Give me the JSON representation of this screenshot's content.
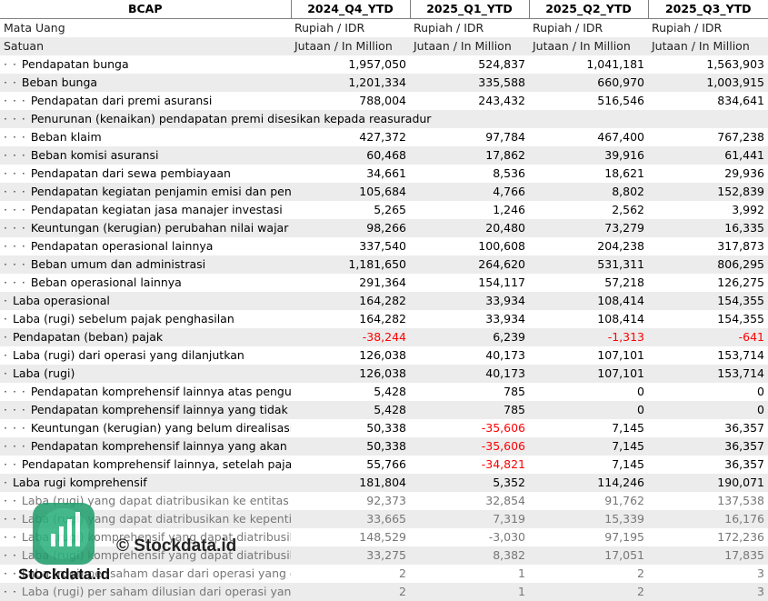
{
  "header": {
    "ticker": "BCAP",
    "periods": [
      "2024_Q4_YTD",
      "2025_Q1_YTD",
      "2025_Q2_YTD",
      "2025_Q3_YTD"
    ]
  },
  "meta_rows": [
    {
      "label": "Mata Uang",
      "values": [
        "Rupiah / IDR",
        "Rupiah / IDR",
        "Rupiah / IDR",
        "Rupiah / IDR"
      ]
    },
    {
      "label": "Satuan",
      "values": [
        "Jutaan / In Million",
        "Jutaan / In Million",
        "Jutaan / In Million",
        "Jutaan / In Million"
      ]
    }
  ],
  "rows": [
    {
      "prefix": "· · ",
      "label": "Pendapatan bunga",
      "values": [
        "1,957,050",
        "524,837",
        "1,041,181",
        "1,563,903"
      ],
      "neg": [
        false,
        false,
        false,
        false
      ]
    },
    {
      "prefix": "· · ",
      "label": "Beban bunga",
      "values": [
        "1,201,334",
        "335,588",
        "660,970",
        "1,003,915"
      ],
      "neg": [
        false,
        false,
        false,
        false
      ]
    },
    {
      "prefix": "· · · ",
      "label": "Pendapatan dari premi asuransi",
      "values": [
        "788,004",
        "243,432",
        "516,546",
        "834,641"
      ],
      "neg": [
        false,
        false,
        false,
        false
      ]
    },
    {
      "prefix": "· · · ",
      "label": "Penurunan (kenaikan) pendapatan premi disesikan kepada reasuradur",
      "values": [
        "",
        "",
        "",
        ""
      ],
      "neg": [
        false,
        false,
        false,
        false
      ],
      "span": true
    },
    {
      "prefix": "· · · ",
      "label": "Beban klaim",
      "values": [
        "427,372",
        "97,784",
        "467,400",
        "767,238"
      ],
      "neg": [
        false,
        false,
        false,
        false
      ]
    },
    {
      "prefix": "· · · ",
      "label": "Beban komisi asuransi",
      "values": [
        "60,468",
        "17,862",
        "39,916",
        "61,441"
      ],
      "neg": [
        false,
        false,
        false,
        false
      ]
    },
    {
      "prefix": "· · · ",
      "label": "Pendapatan dari sewa pembiayaan",
      "values": [
        "34,661",
        "8,536",
        "18,621",
        "29,936"
      ],
      "neg": [
        false,
        false,
        false,
        false
      ]
    },
    {
      "prefix": "· · · ",
      "label": "Pendapatan kegiatan penjamin emisi dan penjua",
      "values": [
        "105,684",
        "4,766",
        "8,802",
        "152,839"
      ],
      "neg": [
        false,
        false,
        false,
        false
      ]
    },
    {
      "prefix": "· · · ",
      "label": "Pendapatan kegiatan jasa manajer investasi",
      "values": [
        "5,265",
        "1,246",
        "2,562",
        "3,992"
      ],
      "neg": [
        false,
        false,
        false,
        false
      ]
    },
    {
      "prefix": "· · · ",
      "label": "Keuntungan (kerugian) perubahan nilai wajar ef",
      "values": [
        "98,266",
        "20,480",
        "73,279",
        "16,335"
      ],
      "neg": [
        false,
        false,
        false,
        false
      ]
    },
    {
      "prefix": "· · · ",
      "label": "Pendapatan operasional lainnya",
      "values": [
        "337,540",
        "100,608",
        "204,238",
        "317,873"
      ],
      "neg": [
        false,
        false,
        false,
        false
      ]
    },
    {
      "prefix": "· · · ",
      "label": "Beban umum dan administrasi",
      "values": [
        "1,181,650",
        "264,620",
        "531,311",
        "806,295"
      ],
      "neg": [
        false,
        false,
        false,
        false
      ]
    },
    {
      "prefix": "· · · ",
      "label": "Beban operasional lainnya",
      "values": [
        "291,364",
        "154,117",
        "57,218",
        "126,275"
      ],
      "neg": [
        false,
        false,
        false,
        false
      ]
    },
    {
      "prefix": "· ",
      "label": "Laba operasional",
      "values": [
        "164,282",
        "33,934",
        "108,414",
        "154,355"
      ],
      "neg": [
        false,
        false,
        false,
        false
      ]
    },
    {
      "prefix": "· ",
      "label": "Laba (rugi) sebelum pajak penghasilan",
      "values": [
        "164,282",
        "33,934",
        "108,414",
        "154,355"
      ],
      "neg": [
        false,
        false,
        false,
        false
      ]
    },
    {
      "prefix": "· ",
      "label": "Pendapatan (beban) pajak",
      "values": [
        "-38,244",
        "6,239",
        "-1,313",
        "-641"
      ],
      "neg": [
        true,
        false,
        true,
        true
      ]
    },
    {
      "prefix": "· ",
      "label": "Laba (rugi) dari operasi yang dilanjutkan",
      "values": [
        "126,038",
        "40,173",
        "107,101",
        "153,714"
      ],
      "neg": [
        false,
        false,
        false,
        false
      ]
    },
    {
      "prefix": "· ",
      "label": "Laba (rugi)",
      "values": [
        "126,038",
        "40,173",
        "107,101",
        "153,714"
      ],
      "neg": [
        false,
        false,
        false,
        false
      ]
    },
    {
      "prefix": "· · · ",
      "label": "Pendapatan komprehensif lainnya atas penguku",
      "values": [
        "5,428",
        "785",
        "0",
        "0"
      ],
      "neg": [
        false,
        false,
        false,
        false
      ]
    },
    {
      "prefix": "· · · ",
      "label": "Pendapatan komprehensif lainnya yang tidak ak",
      "values": [
        "5,428",
        "785",
        "0",
        "0"
      ],
      "neg": [
        false,
        false,
        false,
        false
      ]
    },
    {
      "prefix": "· · · ",
      "label": "Keuntungan (kerugian) yang belum direalisasi at",
      "values": [
        "50,338",
        "-35,606",
        "7,145",
        "36,357"
      ],
      "neg": [
        false,
        true,
        false,
        false
      ]
    },
    {
      "prefix": "· · · ",
      "label": "Pendapatan komprehensif lainnya yang akan dir",
      "values": [
        "50,338",
        "-35,606",
        "7,145",
        "36,357"
      ],
      "neg": [
        false,
        true,
        false,
        false
      ]
    },
    {
      "prefix": "· · ",
      "label": "Pendapatan komprehensif lainnya, setelah pajak",
      "values": [
        "55,766",
        "-34,821",
        "7,145",
        "36,357"
      ],
      "neg": [
        false,
        true,
        false,
        false
      ]
    },
    {
      "prefix": "· ",
      "label": "Laba rugi komprehensif",
      "values": [
        "181,804",
        "5,352",
        "114,246",
        "190,071"
      ],
      "neg": [
        false,
        false,
        false,
        false
      ]
    },
    {
      "prefix": "· · ",
      "label": "Laba (rugi) yang dapat diatribusikan ke entitas ind",
      "values": [
        "92,373",
        "32,854",
        "91,762",
        "137,538"
      ],
      "neg": [
        false,
        false,
        false,
        false
      ]
    },
    {
      "prefix": "· · ",
      "label": "Laba (rugi) yang dapat diatribusikan ke kepenting",
      "values": [
        "33,665",
        "7,319",
        "15,339",
        "16,176"
      ],
      "neg": [
        false,
        false,
        false,
        false
      ]
    },
    {
      "prefix": "· · ",
      "label": "Laba (rugi) komprehensif yang dapat diatribusikan",
      "values": [
        "148,529",
        "-3,030",
        "97,195",
        "172,236"
      ],
      "neg": [
        false,
        true,
        false,
        false
      ]
    },
    {
      "prefix": "· · ",
      "label": "Laba (rugi) komprehensif yang dapat diatribusikan",
      "values": [
        "33,275",
        "8,382",
        "17,051",
        "17,835"
      ],
      "neg": [
        false,
        false,
        false,
        false
      ]
    },
    {
      "prefix": "· · ",
      "label": "Laba (rugi) per saham dasar dari operasi yang dil",
      "values": [
        "2",
        "1",
        "2",
        "3"
      ],
      "neg": [
        false,
        false,
        false,
        false
      ]
    },
    {
      "prefix": "· · ",
      "label": "Laba (rugi) per saham dilusian dari operasi yang",
      "values": [
        "2",
        "1",
        "2",
        "3"
      ],
      "neg": [
        false,
        false,
        false,
        false
      ]
    }
  ],
  "watermark": {
    "brand_main": "© Stockdata.id",
    "brand_small": "Stockdata.id",
    "logo_color": "#1e9d6b"
  }
}
